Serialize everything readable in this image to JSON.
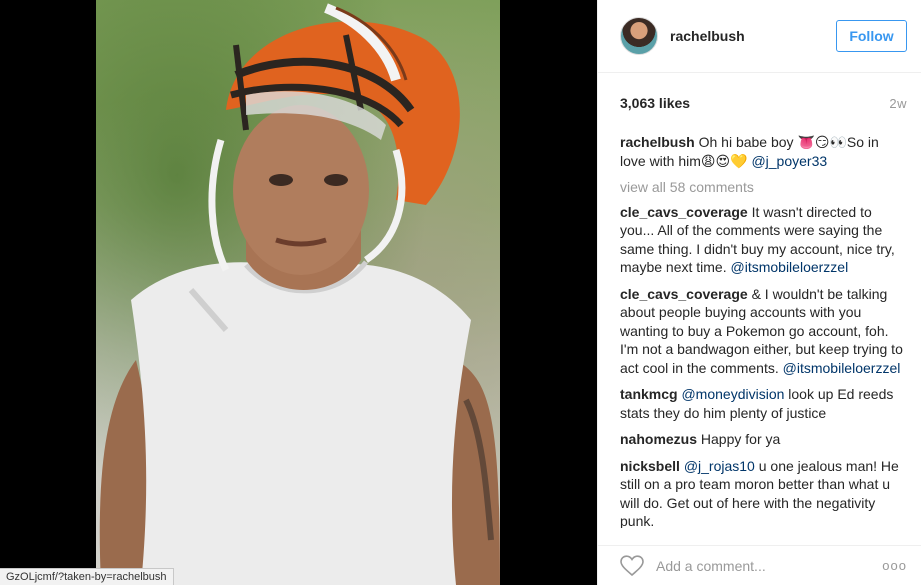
{
  "post": {
    "username": "rachelbush",
    "follow_label": "Follow",
    "likes": "3,063 likes",
    "time": "2w",
    "caption": {
      "author": "rachelbush",
      "text_1": "Oh hi babe boy 👅😏👀So in love with him😩😍💛",
      "mention": "@j_poyer33"
    },
    "view_all": "view all 58 comments",
    "comments": [
      {
        "author": "cle_cavs_coverage",
        "text": "It wasn't directed to you... All of the comments were saying the same thing. I didn't buy my account, nice try, maybe next time.",
        "mention": "@itsmobileloerzzel",
        "mention_first": false
      },
      {
        "author": "cle_cavs_coverage",
        "text": "& I wouldn't be talking about people buying accounts with you wanting to buy a Pokemon go account, foh. I'm not a bandwagon either, but keep trying to act cool in the comments.",
        "mention": "@itsmobileloerzzel",
        "mention_first": false
      },
      {
        "author": "tankmcg",
        "text": "look up Ed reeds stats they do him plenty of justice",
        "mention": "@moneydivision",
        "mention_first": true
      },
      {
        "author": "nahomezus",
        "text": "Happy for ya",
        "mention": "",
        "mention_first": false
      },
      {
        "author": "nicksbell",
        "text": "u one jealous man! He still on a pro team moron better than what u will do. Get out of here with the negativity punk.",
        "mention": "@j_rojas10",
        "mention_first": true
      }
    ],
    "add_comment_placeholder": "Add a comment...",
    "more_label": "ooo"
  },
  "status_url": "GzOLjcmf/?taken-by=rachelbush",
  "colors": {
    "link": "#3897f0",
    "mention": "#003569",
    "muted": "#999999"
  }
}
